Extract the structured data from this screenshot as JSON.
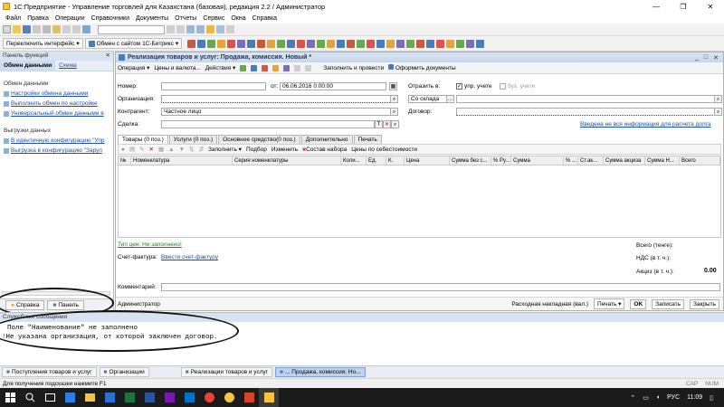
{
  "window": {
    "title": "1С:Предприятие - Управление торговлей для Казахстана (базовая), редакция 2.2 / Администратор"
  },
  "menu": [
    "Файл",
    "Правка",
    "Операции",
    "Справочники",
    "Документы",
    "Отчеты",
    "Сервис",
    "Окна",
    "Справка"
  ],
  "toolbar2": {
    "switch_label": "Переключить интерфейс",
    "exchange_label": "Обмен с сайтом 1С-Битрикс"
  },
  "side": {
    "header": "Панель функций",
    "tab_active": "Обмен данными",
    "tab_other": "Схема",
    "section1": "Обмен данными",
    "links1": [
      "Настройки обмена данными",
      "Выполнить обмен по настройке",
      "Универсальный обмен данными в"
    ],
    "section2": "Выгрузки данных",
    "links2": [
      "В идентичную конфигурацию \"Упр",
      "Выгрузка в конфигурацию \"Заруп"
    ],
    "btn_help": "Справка",
    "btn_panel": "Панель"
  },
  "doc": {
    "title": "Реализация товаров и услуг: Продажа, комиссия. Новый *",
    "toolbar": [
      "Операция",
      "Цены и валюта...",
      "Действия",
      "Заполнить и провести",
      "Оформить документы"
    ],
    "labels": {
      "number": "Номер:",
      "date_from": "от:",
      "reflect": "Отразить в:",
      "upr": "упр. учете",
      "buh": "бух. учете",
      "org": "Организация:",
      "contractor": "Контрагент:",
      "contract": "Договор:",
      "deal": "Сделка:"
    },
    "values": {
      "date": "06.06.2016  0:00:00",
      "warehouse": "Со склада",
      "contractor": "Частное лицо",
      "deal_note": "Введена не вся информация для расчета долга"
    },
    "tabs": [
      "Товары (0 поз.)",
      "Услуги (0 поз.)",
      "Основное средство(0 поз.)",
      "Дополнительно",
      "Печать"
    ],
    "tab_toolbar": [
      "Заполнить",
      "Подбор",
      "Изменить",
      "Состав набора",
      "Цены по себестоимости"
    ],
    "columns": [
      "№",
      "Номенклатура",
      "Серия номенклатуры",
      "Коли...",
      "Ед.",
      "К.",
      "Цена",
      "Сумма без с...",
      "% Ру...",
      "Сумма",
      "% ...",
      "Ст.ак...",
      "Сумма акциза",
      "Сумма Н...",
      "Всего"
    ],
    "price_type_label": "Тип цен: Не заполнено!",
    "invoice_label": "Счет-фактура:",
    "invoice_link": "Ввести счет-фактуру",
    "total_label": "Всего (тенге):",
    "vat_label": "НДС (в т. ч.):",
    "excise_label": "Акциз (в т. ч.):",
    "excise_value": "0.00",
    "comment_label": "Комментарий:",
    "responsible": "Администратор",
    "footer": [
      "Расходная накладная (вал.)",
      "Печать",
      "OK",
      "Записать",
      "Закрыть"
    ]
  },
  "messages": {
    "header": "Служебные сообщения",
    "lines": [
      "Поле \"Наименование\" не заполнено",
      "Не указана организация, от которой заключен договор."
    ]
  },
  "windows": [
    "Поступления товаров и услуг",
    "Организации",
    "Реализации товаров и услуг",
    "... Продажа, комиссия. Но..."
  ],
  "status": {
    "hint": "Для получения подсказки нажмите F1",
    "cap": "CAP",
    "num": "NUM"
  },
  "taskbar": {
    "lang": "РУС",
    "time": "11:09"
  }
}
